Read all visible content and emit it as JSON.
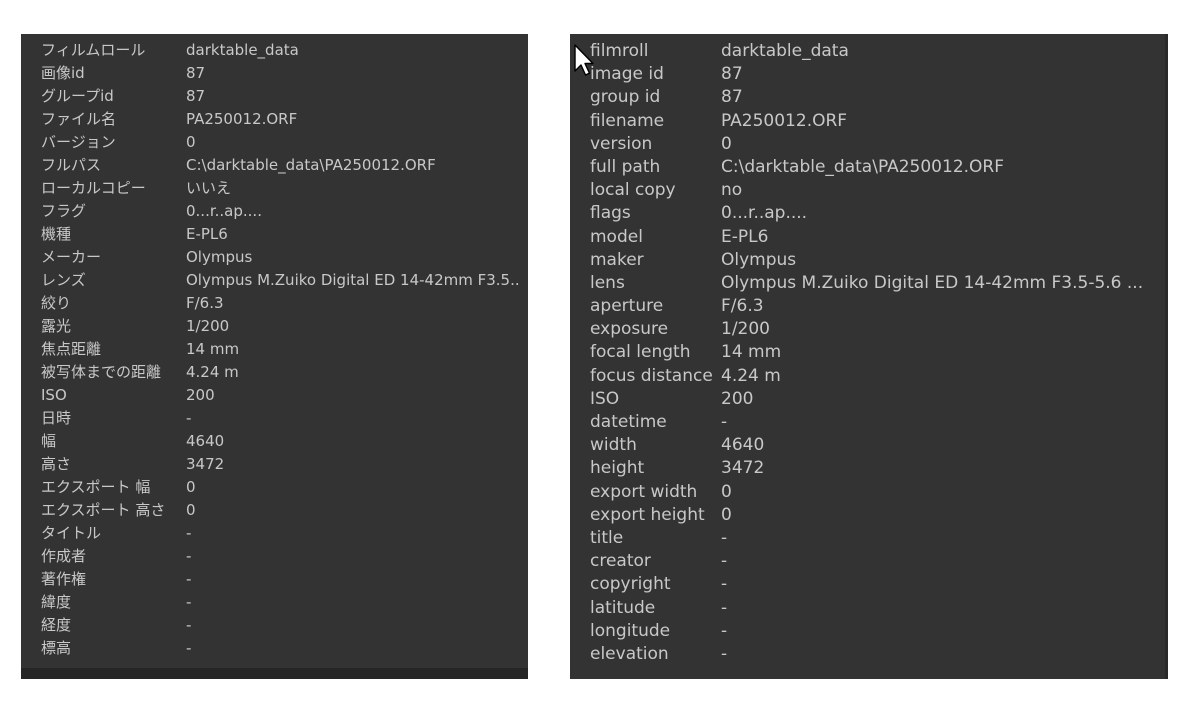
{
  "panels": [
    {
      "language": "ja",
      "rows": [
        {
          "label": "フィルムロール",
          "value": "darktable_data"
        },
        {
          "label": "画像id",
          "value": "87"
        },
        {
          "label": "グループid",
          "value": "87"
        },
        {
          "label": "ファイル名",
          "value": "PA250012.ORF"
        },
        {
          "label": "バージョン",
          "value": "0"
        },
        {
          "label": "フルパス",
          "value": "C:\\darktable_data\\PA250012.ORF"
        },
        {
          "label": "ローカルコピー",
          "value": "いいえ"
        },
        {
          "label": "フラグ",
          "value": "0...r..ap...."
        },
        {
          "label": "機種",
          "value": "E-PL6"
        },
        {
          "label": "メーカー",
          "value": "Olympus"
        },
        {
          "label": "レンズ",
          "value": "Olympus M.Zuiko Digital ED 14-42mm F3.5..."
        },
        {
          "label": "絞り",
          "value": "F/6.3"
        },
        {
          "label": "露光",
          "value": "1/200"
        },
        {
          "label": "焦点距離",
          "value": "14 mm"
        },
        {
          "label": "被写体までの距離",
          "value": "4.24 m"
        },
        {
          "label": "ISO",
          "value": "200"
        },
        {
          "label": "日時",
          "value": "-"
        },
        {
          "label": "幅",
          "value": "4640"
        },
        {
          "label": "高さ",
          "value": "3472"
        },
        {
          "label": "エクスポート 幅",
          "value": "0"
        },
        {
          "label": "エクスポート 高さ",
          "value": "0"
        },
        {
          "label": "タイトル",
          "value": "-"
        },
        {
          "label": "作成者",
          "value": "-"
        },
        {
          "label": "著作権",
          "value": "-"
        },
        {
          "label": "緯度",
          "value": "-"
        },
        {
          "label": "経度",
          "value": "-"
        },
        {
          "label": "標高",
          "value": "-"
        }
      ]
    },
    {
      "language": "en",
      "rows": [
        {
          "label": "filmroll",
          "value": "darktable_data"
        },
        {
          "label": "image id",
          "value": "87"
        },
        {
          "label": "group id",
          "value": "87"
        },
        {
          "label": "filename",
          "value": "PA250012.ORF"
        },
        {
          "label": "version",
          "value": "0"
        },
        {
          "label": "full path",
          "value": "C:\\darktable_data\\PA250012.ORF"
        },
        {
          "label": "local copy",
          "value": "no"
        },
        {
          "label": "flags",
          "value": "0...r..ap...."
        },
        {
          "label": "model",
          "value": "E-PL6"
        },
        {
          "label": "maker",
          "value": "Olympus"
        },
        {
          "label": "lens",
          "value": "Olympus M.Zuiko Digital ED 14-42mm F3.5-5.6 ..."
        },
        {
          "label": "aperture",
          "value": "F/6.3"
        },
        {
          "label": "exposure",
          "value": "1/200"
        },
        {
          "label": "focal length",
          "value": "14 mm"
        },
        {
          "label": "focus distance",
          "value": "4.24 m"
        },
        {
          "label": "ISO",
          "value": "200"
        },
        {
          "label": "datetime",
          "value": "-"
        },
        {
          "label": "width",
          "value": "4640"
        },
        {
          "label": "height",
          "value": "3472"
        },
        {
          "label": "export width",
          "value": "0"
        },
        {
          "label": "export height",
          "value": "0"
        },
        {
          "label": "title",
          "value": "-"
        },
        {
          "label": "creator",
          "value": "-"
        },
        {
          "label": "copyright",
          "value": "-"
        },
        {
          "label": "latitude",
          "value": "-"
        },
        {
          "label": "longitude",
          "value": "-"
        },
        {
          "label": "elevation",
          "value": "-"
        }
      ]
    }
  ],
  "cursor": {
    "icon": "mouse-pointer-icon"
  },
  "colors": {
    "panel_background": "#333333",
    "text": "#c8c8c8",
    "page_background": "#ffffff"
  }
}
